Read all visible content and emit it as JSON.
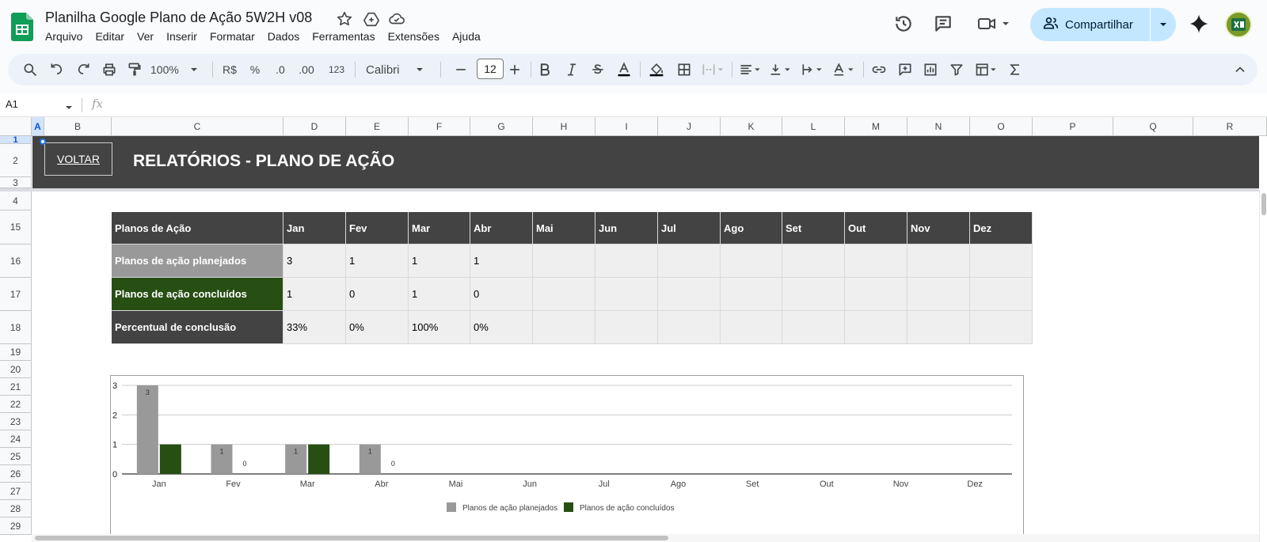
{
  "document": {
    "title": "Planilha Google Plano de Ação 5W2H v08",
    "menu": [
      "Arquivo",
      "Editar",
      "Ver",
      "Inserir",
      "Formatar",
      "Dados",
      "Ferramentas",
      "Extensões",
      "Ajuda"
    ],
    "share_label": "Compartilhar"
  },
  "toolbar": {
    "zoom": "100%",
    "currency": "R$",
    "percent": "%",
    "dec_decrease": ".0",
    "dec_increase": ".00",
    "number_format": "123",
    "font": "Calibri",
    "font_size": "12"
  },
  "formula_bar": {
    "cell_ref": "A1",
    "fx": "fx"
  },
  "grid": {
    "columns": [
      "A",
      "B",
      "C",
      "D",
      "E",
      "F",
      "G",
      "H",
      "I",
      "J",
      "K",
      "L",
      "M",
      "N",
      "O",
      "P",
      "Q",
      "R"
    ],
    "rows": [
      "1",
      "2",
      "3",
      "4",
      "15",
      "16",
      "17",
      "18",
      "19",
      "20",
      "21",
      "22",
      "23",
      "24",
      "25",
      "26",
      "27",
      "28",
      "29"
    ]
  },
  "banner": {
    "back_button": "VOLTAR",
    "title": "RELATÓRIOS - PLANO DE AÇÃO"
  },
  "table": {
    "header": [
      "Planos de Ação",
      "Jan",
      "Fev",
      "Mar",
      "Abr",
      "Mai",
      "Jun",
      "Jul",
      "Ago",
      "Set",
      "Out",
      "Nov",
      "Dez"
    ],
    "rows": [
      {
        "label": "Planos de ação planejados",
        "values": [
          "3",
          "1",
          "1",
          "1",
          "",
          "",
          "",
          "",
          "",
          "",
          "",
          ""
        ]
      },
      {
        "label": "Planos de ação concluídos",
        "values": [
          "1",
          "0",
          "1",
          "0",
          "",
          "",
          "",
          "",
          "",
          "",
          "",
          ""
        ]
      },
      {
        "label": "Percentual de conclusão",
        "values": [
          "33%",
          "0%",
          "100%",
          "0%",
          "",
          "",
          "",
          "",
          "",
          "",
          "",
          ""
        ]
      }
    ]
  },
  "chart_data": {
    "type": "bar",
    "categories": [
      "Jan",
      "Fev",
      "Mar",
      "Abr",
      "Mai",
      "Jun",
      "Jul",
      "Ago",
      "Set",
      "Out",
      "Nov",
      "Dez"
    ],
    "series": [
      {
        "name": "Planos de ação planejados",
        "values": [
          3,
          1,
          1,
          1,
          null,
          null,
          null,
          null,
          null,
          null,
          null,
          null
        ],
        "color": "#999999"
      },
      {
        "name": "Planos de ação concluídos",
        "values": [
          1,
          0,
          1,
          0,
          null,
          null,
          null,
          null,
          null,
          null,
          null,
          null
        ],
        "color": "#274e13"
      }
    ],
    "data_labels": [
      [
        "3",
        "1",
        "1",
        "1"
      ],
      [
        "",
        "0",
        "",
        "0"
      ]
    ],
    "yticks": [
      "0",
      "1",
      "2",
      "3"
    ],
    "ylim": [
      0,
      3
    ],
    "grid": true,
    "legend": "bottom",
    "title": "",
    "xlabel": "",
    "ylabel": ""
  }
}
